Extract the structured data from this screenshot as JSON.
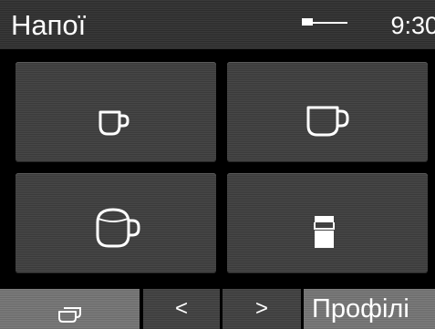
{
  "header": {
    "title": "Напої",
    "time": "9:30",
    "status_indicator_icon": "progress-indicator-icon"
  },
  "tiles": [
    {
      "icon": "small-cup-icon"
    },
    {
      "icon": "medium-cup-icon"
    },
    {
      "icon": "large-cup-icon"
    },
    {
      "icon": "glass-icon"
    }
  ],
  "bottombar": {
    "cups_icon": "stacked-cups-icon",
    "prev_label": "<",
    "next_label": ">",
    "profiles_label": "Профілі"
  },
  "colors": {
    "background": "#000000",
    "tile": "#424242",
    "highlight_segment": "#747474",
    "icon": "#ffffff"
  }
}
